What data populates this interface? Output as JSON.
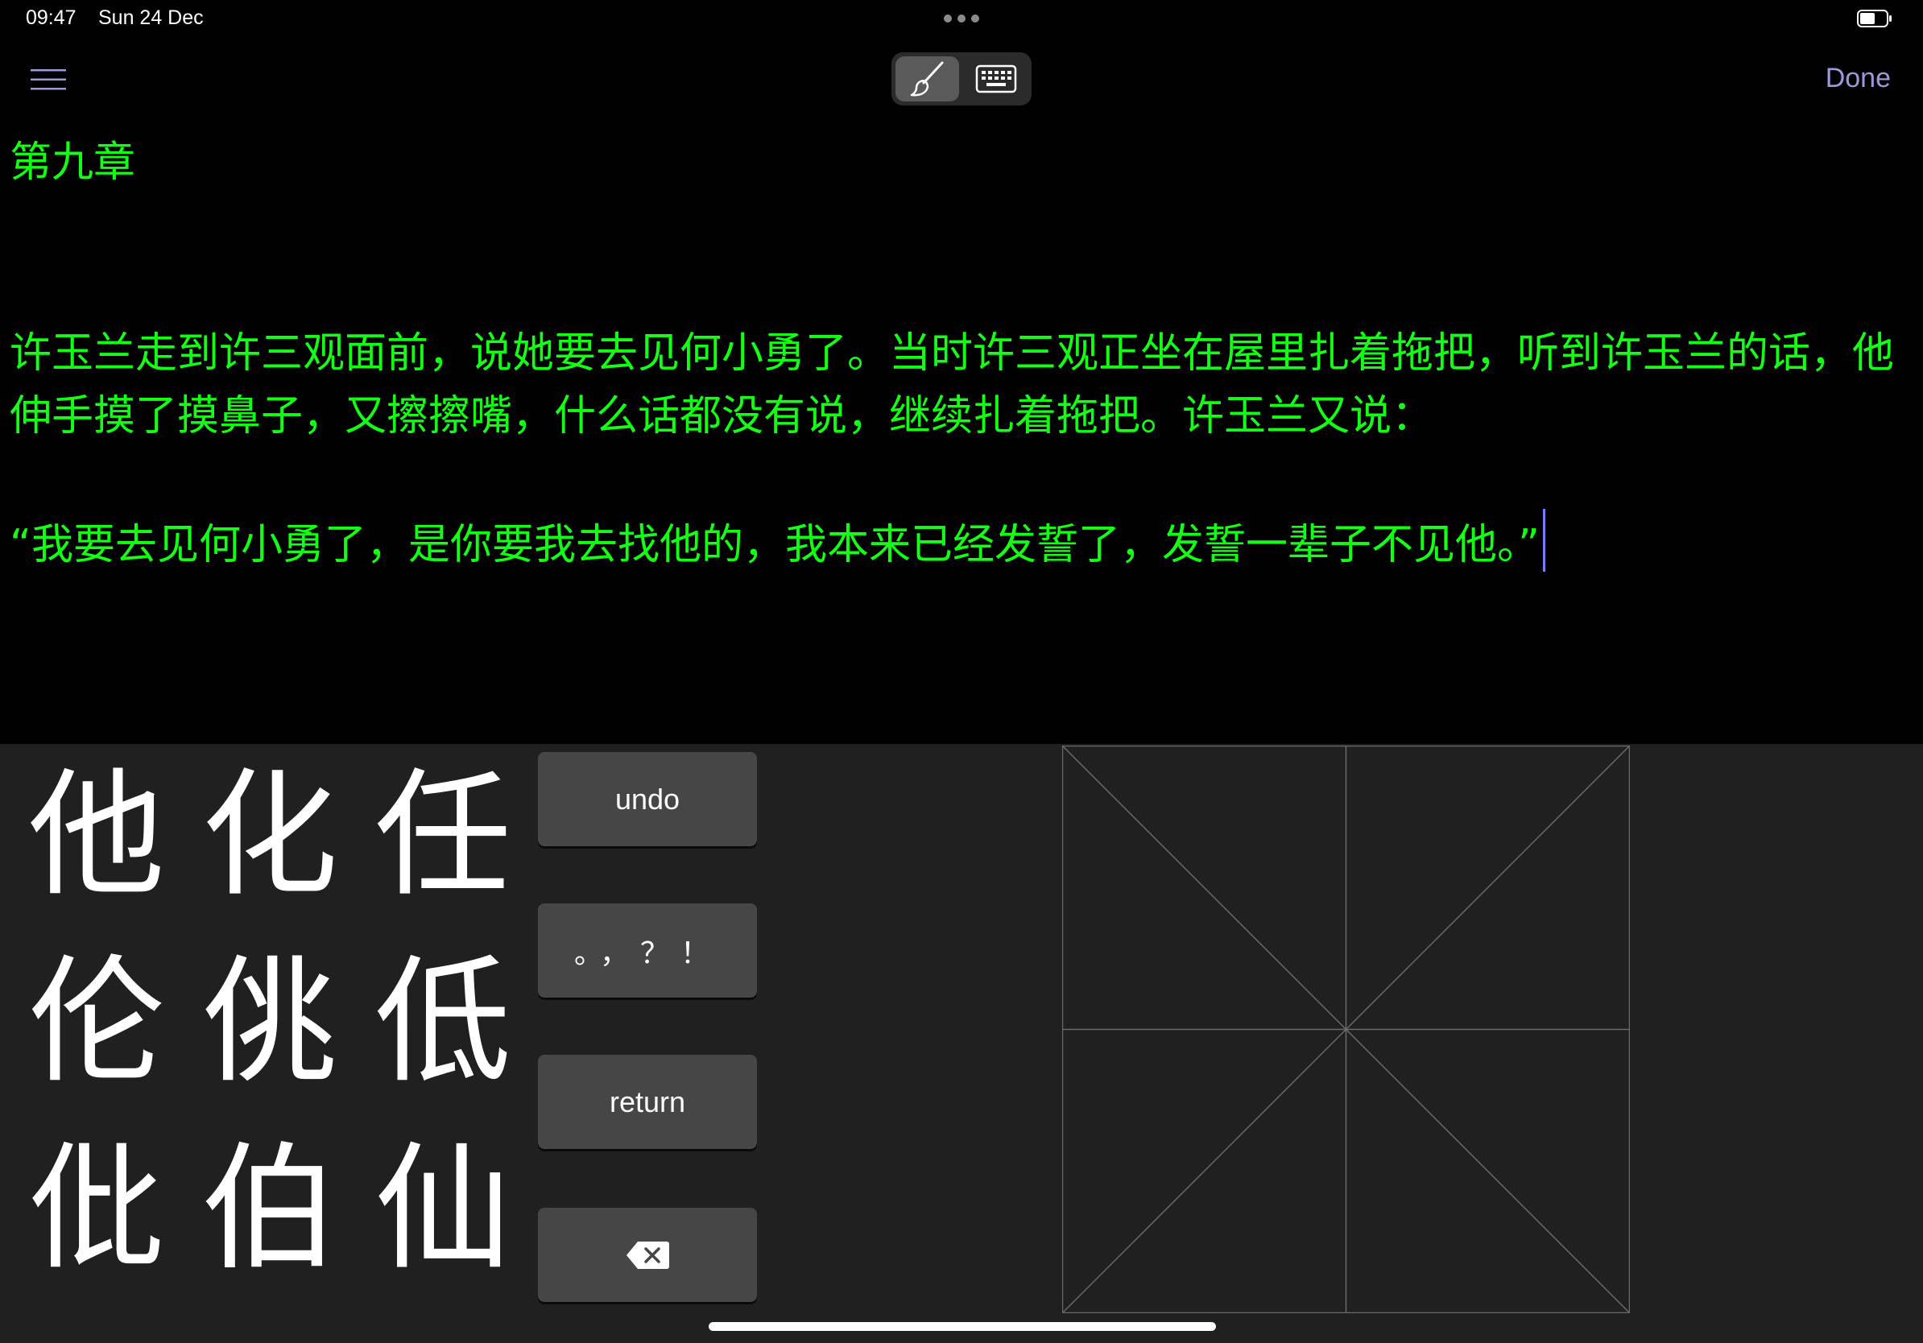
{
  "status_bar": {
    "time": "09:47",
    "date": "Sun 24 Dec"
  },
  "toolbar": {
    "done_label": "Done"
  },
  "icons": {
    "menu": "hamburger-menu-icon",
    "handwriting": "brush-icon",
    "keyboard": "keyboard-icon",
    "battery": "battery-icon",
    "delete": "delete-backward-icon"
  },
  "editor": {
    "chapter_title": "第九章",
    "paragraph_1": " 许玉兰走到许三观面前，说她要去见何小勇了。当时许三观正坐在屋里扎着拖把，听到许玉兰的话，他伸手摸了摸鼻子，又擦擦嘴，什么话都没有说，继续扎着拖把。许玉兰又说：",
    "paragraph_2": " “我要去见何小勇了，是你要我去找他的，我本来已经发誓了，发誓一辈子不见他。”"
  },
  "candidates": [
    "他",
    "化",
    "任",
    "伦",
    "佻",
    "低",
    "仳",
    "伯",
    "仙"
  ],
  "keys": {
    "undo_label": "undo",
    "punctuation_label": "。，？！",
    "return_label": "return"
  },
  "colors": {
    "text_green": "#13ff13",
    "accent": "#9b98dc",
    "panel_bg": "#202020",
    "key_bg": "#464646"
  }
}
